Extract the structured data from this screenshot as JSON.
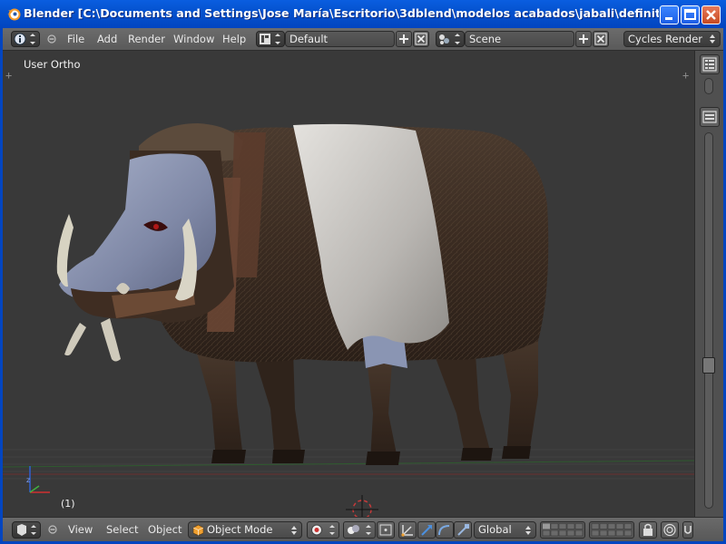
{
  "window": {
    "title": "Blender [C:\\Documents and Settings\\Jose María\\Escritorio\\3dblend\\modelos acabados\\jabali\\definitivos\\acaba..."
  },
  "menu": {
    "items": [
      "File",
      "Add",
      "Render",
      "Window",
      "Help"
    ],
    "layout_value": "Default",
    "scene_value": "Scene",
    "render_engine": "Cycles Render"
  },
  "viewport": {
    "view_label": "User Ortho",
    "frame_label": "(1)"
  },
  "footer": {
    "menu_items": [
      "View",
      "Select",
      "Object"
    ],
    "mode_value": "Object Mode",
    "orientation_value": "Global"
  },
  "colors": {
    "titlebar": "#0552cf",
    "viewport_bg": "#393939",
    "header_bg": "#606060",
    "axis_x": "#d03030",
    "axis_y": "#40b040",
    "axis_z": "#3060d0"
  },
  "icons": {
    "app": "blender-logo-icon",
    "editor_type": "info-editor-icon",
    "layout": "screen-layout-icon",
    "scene": "scene-icon",
    "mode": "object-mode-cube-icon",
    "viewport_shading": "solid-shading-icon"
  }
}
